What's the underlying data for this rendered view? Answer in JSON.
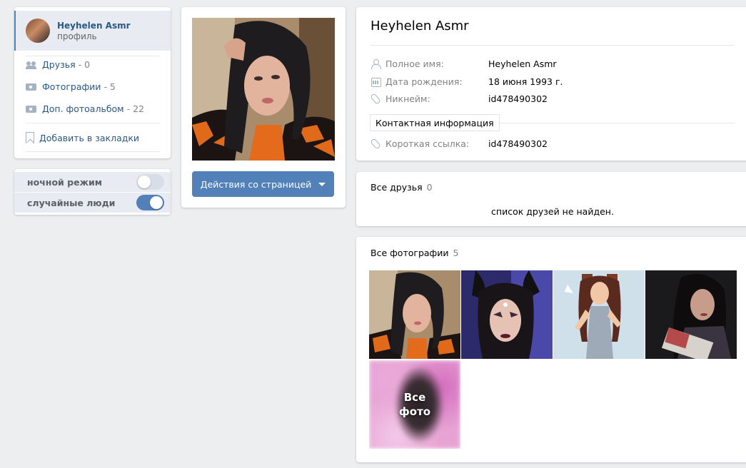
{
  "menu": {
    "profile_name": "Heyhelen Asmr",
    "profile_sub": "профиль",
    "items": [
      {
        "label": "Друзья",
        "count": "- 0",
        "icon": "friends-icon"
      },
      {
        "label": "Фотографии",
        "count": "- 5",
        "icon": "camera-icon"
      },
      {
        "label": "Доп. фотоальбом",
        "count": "- 22",
        "icon": "camera-icon"
      }
    ],
    "bookmark": "Добавить в закладки"
  },
  "toggles": [
    {
      "label": "ночной режим",
      "on": false
    },
    {
      "label": "случайные люди",
      "on": true
    }
  ],
  "avatar": {
    "actions_button": "Действия со страницей"
  },
  "info": {
    "name": "Heyhelen Asmr",
    "fields": [
      {
        "label": "Полное имя:",
        "value": "Heyhelen Asmr",
        "icon": "user-icon"
      },
      {
        "label": "Дата рождения:",
        "value": "18 июня 1993 г.",
        "icon": "calendar-icon"
      },
      {
        "label": "Никнейм:",
        "value": "id478490302",
        "icon": "clip-icon"
      }
    ],
    "contact_button": "Контактная информация",
    "short_link": {
      "label": "Короткая ссылка:",
      "value": "id478490302",
      "icon": "clip-icon"
    }
  },
  "friends": {
    "title": "Все друзья",
    "count": "0",
    "empty": "список друзей не найден."
  },
  "photos": {
    "title": "Все фотографии",
    "count": "5",
    "all_label_1": "Все",
    "all_label_2": "фото"
  },
  "colors": {
    "accent": "#5181b8",
    "link": "#2a5885",
    "background": "#edeef0"
  }
}
